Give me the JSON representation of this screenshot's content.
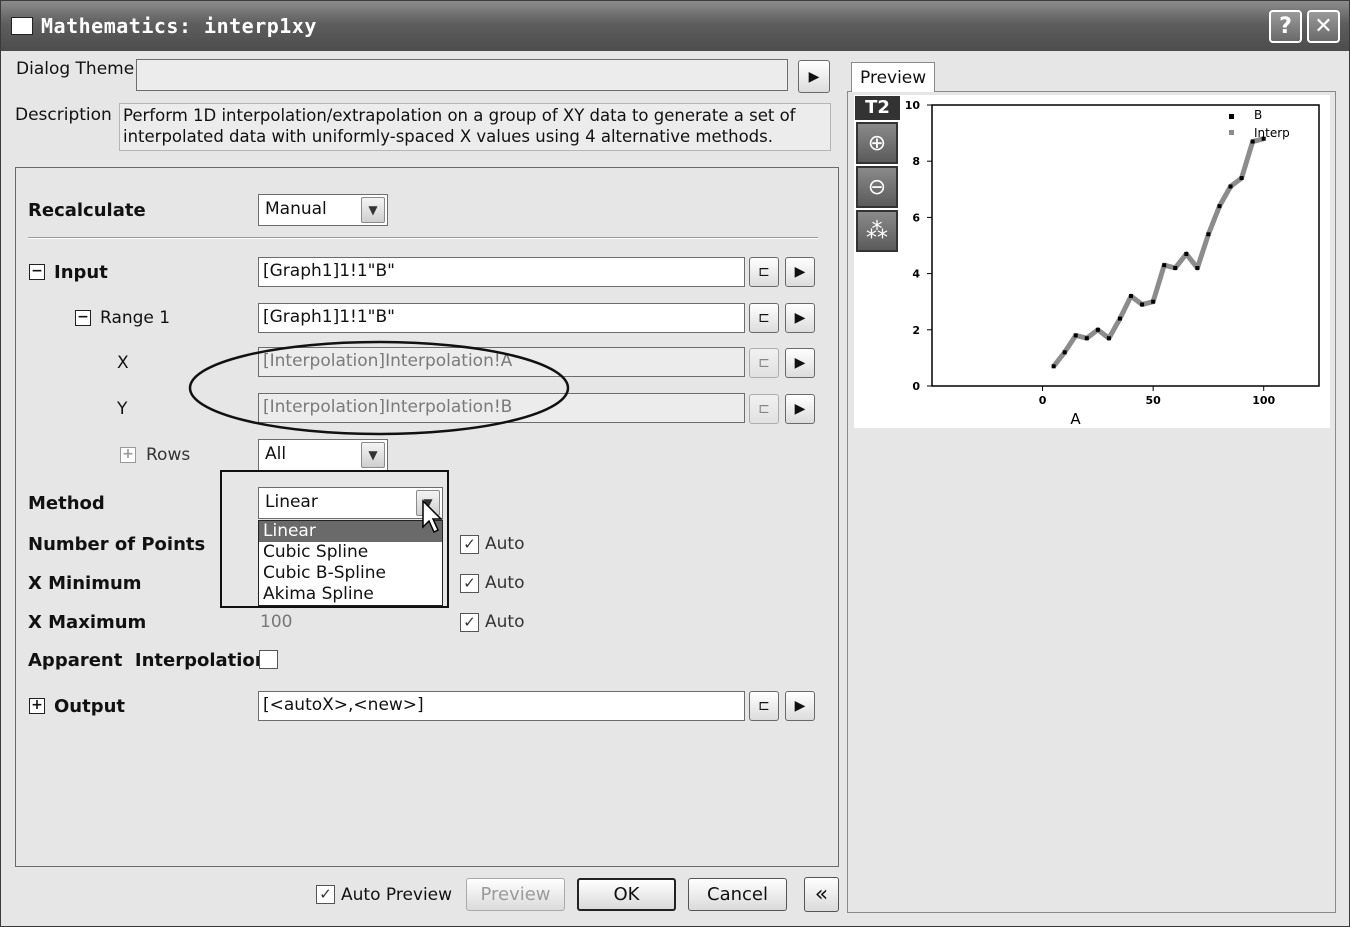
{
  "window": {
    "title": "Mathematics: interp1xy",
    "help_glyph": "?",
    "close_glyph": "✕"
  },
  "dialog_theme": {
    "label": "Dialog Theme",
    "value": ""
  },
  "description": {
    "label": "Description",
    "text": "Perform 1D interpolation/extrapolation on a group of XY data to generate a set of interpolated data with uniformly-spaced X values using 4 alternative methods."
  },
  "recalculate": {
    "label": "Recalculate",
    "value": "Manual"
  },
  "input": {
    "label": "Input",
    "value": "[Graph1]1!1\"B\"",
    "range1": {
      "label": "Range 1",
      "value": "[Graph1]1!1\"B\""
    },
    "x": {
      "label": "X",
      "value": "[Interpolation]Interpolation!A"
    },
    "y": {
      "label": "Y",
      "value": "[Interpolation]Interpolation!B"
    },
    "rows": {
      "label": "Rows",
      "value": "All"
    }
  },
  "method": {
    "label": "Method",
    "value": "Linear",
    "options": [
      "Linear",
      "Cubic Spline",
      "Cubic B-Spline",
      "Akima Spline"
    ],
    "selected_index": 0
  },
  "number_of_points": {
    "label": "Number of Points",
    "auto_label": "Auto",
    "auto": true
  },
  "x_minimum": {
    "label": "X Minimum",
    "auto_label": "Auto",
    "auto": true
  },
  "x_maximum": {
    "label": "X Maximum",
    "value": "100",
    "auto_label": "Auto",
    "auto": true
  },
  "apparent_interpolation": {
    "label": "Apparent  Interpolation",
    "checked": false
  },
  "output": {
    "label": "Output",
    "value": "[<autoX>,<new>]"
  },
  "footer": {
    "auto_preview_label": "Auto Preview",
    "auto_preview_checked": true,
    "preview_button": "Preview",
    "ok_button": "OK",
    "cancel_button": "Cancel",
    "collapse_glyph": "«"
  },
  "preview_panel": {
    "tab_label": "Preview",
    "layer_label": "T2"
  },
  "chart_data": {
    "type": "line",
    "title": "",
    "xlabel": "A",
    "ylabel": "",
    "xlim": [
      -50,
      125
    ],
    "ylim": [
      0,
      10
    ],
    "x_ticks": [
      "0",
      "50",
      "100"
    ],
    "y_ticks": [
      "0",
      "2",
      "4",
      "6",
      "8",
      "10"
    ],
    "legend_position": "top-right",
    "series": [
      {
        "name": "B",
        "style": "scatter",
        "color": "#000000",
        "x": [
          5,
          10,
          15,
          20,
          25,
          30,
          35,
          40,
          45,
          50,
          55,
          60,
          65,
          70,
          75,
          80,
          85,
          90,
          95,
          100
        ],
        "y": [
          0.7,
          1.2,
          1.8,
          1.7,
          2.0,
          1.7,
          2.4,
          3.2,
          2.9,
          3.0,
          4.3,
          4.2,
          4.7,
          4.2,
          5.4,
          6.4,
          7.1,
          7.4,
          8.7,
          8.8
        ]
      },
      {
        "name": "Interp",
        "style": "line",
        "color": "#8c8c8c",
        "x": [
          5,
          10,
          15,
          20,
          25,
          30,
          35,
          40,
          45,
          50,
          55,
          60,
          65,
          70,
          75,
          80,
          85,
          90,
          95,
          100
        ],
        "y": [
          0.7,
          1.2,
          1.8,
          1.7,
          2.0,
          1.7,
          2.4,
          3.2,
          2.9,
          3.0,
          4.3,
          4.2,
          4.7,
          4.2,
          5.4,
          6.4,
          7.1,
          7.4,
          8.7,
          8.8
        ]
      }
    ]
  }
}
